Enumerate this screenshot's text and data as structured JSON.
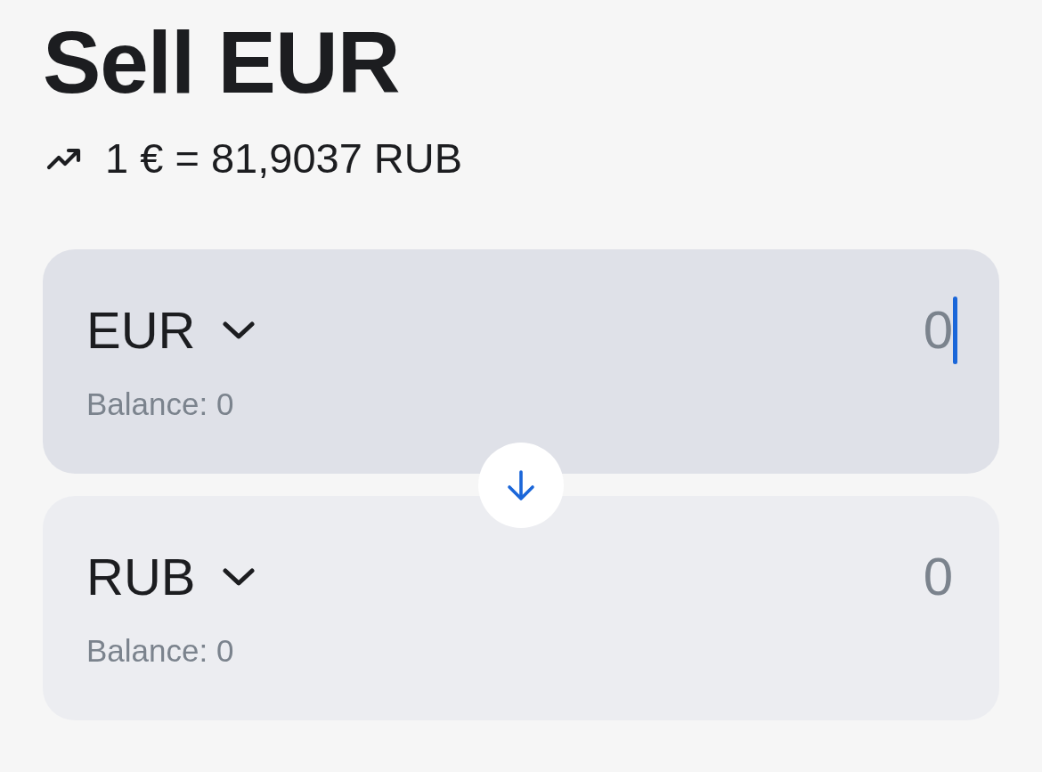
{
  "title": "Sell EUR",
  "rate": "1 € = 81,9037 RUB",
  "cards": [
    {
      "currency": "EUR",
      "amount": {
        "placeholder": "0"
      },
      "balance": "Balance: 0",
      "focused": true
    },
    {
      "currency": "RUB",
      "amount": {
        "placeholder": "0"
      },
      "balance": "Balance: 0",
      "focused": false
    }
  ]
}
